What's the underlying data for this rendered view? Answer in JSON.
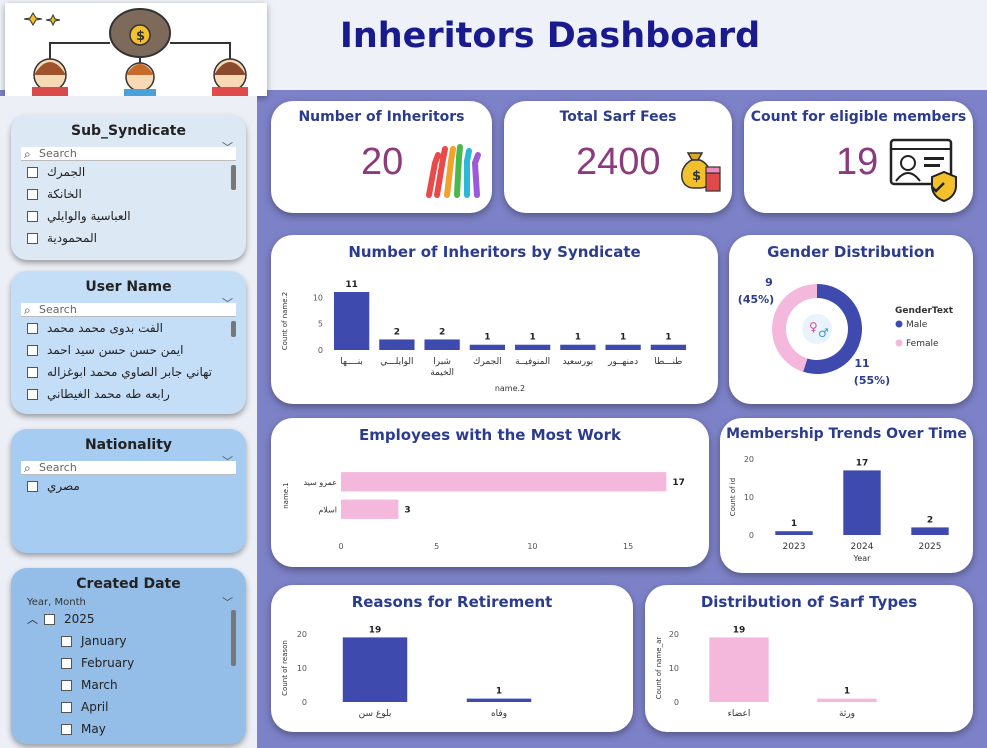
{
  "header": {
    "title": "Inheritors Dashboard",
    "logo_icon": "money-bag-inheritors-icon"
  },
  "slicers": {
    "sub_syndicate": {
      "title": "Sub_Syndicate",
      "placeholder": "Search",
      "items": [
        "الجمرك",
        "الخانكة",
        "العباسية والوايلي",
        "المحمودية"
      ]
    },
    "user_name": {
      "title": "User Name",
      "placeholder": "Search",
      "items": [
        "الفت بدوى محمد محمد",
        "ايمن حسن حسن سيد احمد",
        "تهاني جابر الصاوي محمد ابوغزاله",
        "رابعه طه محمد الغيطاني"
      ]
    },
    "nationality": {
      "title": "Nationality",
      "placeholder": "Search",
      "items": [
        "مصري"
      ]
    },
    "created_date": {
      "title": "Created Date",
      "subtitle": "Year, Month",
      "year": "2025",
      "months": [
        "January",
        "February",
        "March",
        "April",
        "May"
      ]
    }
  },
  "kpis": {
    "inheritors": {
      "title": "Number of Inheritors",
      "value": "20",
      "icon": "raised-hands-icon"
    },
    "sarf_fees": {
      "title": "Total Sarf Fees",
      "value": "2400",
      "icon": "money-bag-icon"
    },
    "eligible": {
      "title": "Count for eligible members",
      "value": "19",
      "icon": "member-id-card-icon"
    }
  },
  "colors": {
    "navy": "#3e4aad",
    "pink": "#f3b8dc",
    "title": "#2b3b8f",
    "kpi": "#8b3a7e"
  },
  "chart_data": [
    {
      "id": "syndicate",
      "type": "bar",
      "title": "Number of Inheritors by Syndicate",
      "xlabel": "name.2",
      "ylabel": "Count of name.2",
      "categories": [
        "بنــــها",
        "الوايلـــي",
        "شبرا الخيمة",
        "الجمرك",
        "المنوفيــة",
        "بورسعيد",
        "دمنهــور",
        "طنـــطا"
      ],
      "values": [
        11,
        2,
        2,
        1,
        1,
        1,
        1,
        1
      ],
      "yticks": [
        0,
        5,
        10
      ],
      "ylim": [
        0,
        11
      ],
      "color": "#3e4aad"
    },
    {
      "id": "gender",
      "type": "pie",
      "title": "Gender Distribution",
      "legend_title": "GenderText",
      "labels": [
        "Male",
        "Female"
      ],
      "values": [
        11,
        9
      ],
      "data_labels": [
        "11",
        "9"
      ],
      "percent_labels": [
        "(55%)",
        "(45%)"
      ],
      "colors": [
        "#3e4aad",
        "#f3b8dc"
      ]
    },
    {
      "id": "employees",
      "type": "bar",
      "orientation": "horizontal",
      "title": "Employees with the Most Work",
      "ylabel": "name.1",
      "categories": [
        "عمرو سيد",
        "اسلام"
      ],
      "values": [
        17,
        3
      ],
      "xticks": [
        0,
        5,
        10,
        15
      ],
      "xlim": [
        0,
        17.5
      ],
      "color": "#f3b8dc"
    },
    {
      "id": "membership",
      "type": "bar",
      "title": "Membership Trends Over Time",
      "xlabel": "Year",
      "ylabel": "Count of id",
      "categories": [
        "2023",
        "2024",
        "2025"
      ],
      "values": [
        1,
        17,
        2
      ],
      "yticks": [
        0,
        10,
        20
      ],
      "ylim": [
        0,
        20
      ],
      "color": "#3e4aad"
    },
    {
      "id": "retirement",
      "type": "bar",
      "title": "Reasons for Retirement",
      "ylabel": "Count of reason",
      "categories": [
        "بلوغ سن",
        "وفاه"
      ],
      "values": [
        19,
        1
      ],
      "yticks": [
        0,
        10,
        20
      ],
      "ylim": [
        0,
        20
      ],
      "color": "#3e4aad"
    },
    {
      "id": "sarf",
      "type": "bar",
      "title": "Distribution of Sarf Types",
      "ylabel": "Count of name_ar",
      "categories": [
        "اعضاء",
        "ورثة"
      ],
      "values": [
        19,
        1
      ],
      "yticks": [
        0,
        10,
        20
      ],
      "ylim": [
        0,
        20
      ],
      "color": "#f3b8dc"
    }
  ]
}
